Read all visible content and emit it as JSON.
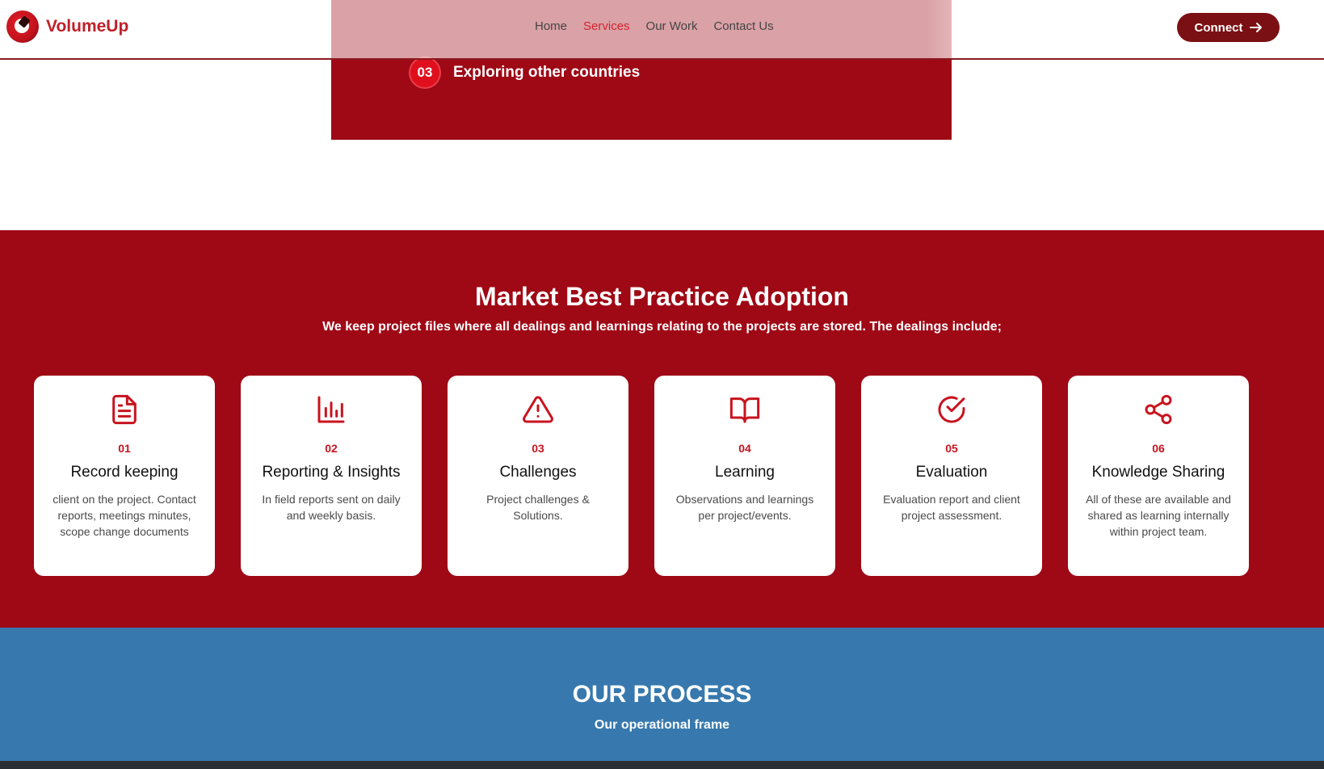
{
  "header": {
    "brand": "VolumeUp",
    "nav": [
      {
        "label": "Home",
        "active": false
      },
      {
        "label": "Services",
        "active": true
      },
      {
        "label": "Our Work",
        "active": false
      },
      {
        "label": "Contact Us",
        "active": false
      }
    ],
    "connect_label": "Connect",
    "connect_icon": "arrow-right-icon"
  },
  "top_step": {
    "number": "03",
    "label": "Exploring other countries"
  },
  "practices": {
    "title": "Market Best Practice Adoption",
    "subtitle": "We keep project files where all dealings and learnings relating to the projects are stored. The dealings include;",
    "cards": [
      {
        "icon": "document-icon",
        "number": "01",
        "title": "Record keeping",
        "description": "client on the project. Contact reports, meetings minutes, scope change documents"
      },
      {
        "icon": "bar-chart-icon",
        "number": "02",
        "title": "Reporting & Insights",
        "description": "In field reports sent on daily and weekly basis."
      },
      {
        "icon": "warning-icon",
        "number": "03",
        "title": "Challenges",
        "description": "Project challenges & Solutions."
      },
      {
        "icon": "book-icon",
        "number": "04",
        "title": "Learning",
        "description": "Observations and learnings per project/events."
      },
      {
        "icon": "check-circle-icon",
        "number": "05",
        "title": "Evaluation",
        "description": "Evaluation report and client project assessment."
      },
      {
        "icon": "share-icon",
        "number": "06",
        "title": "Knowledge Sharing",
        "description": "All of these are available and shared as learning internally within project team."
      }
    ]
  },
  "process": {
    "title": "OUR PROCESS",
    "subtitle": "Our operational frame"
  },
  "colors": {
    "brand_red": "#9f0815",
    "accent_red": "#c8141f",
    "process_blue": "#3779ae",
    "connect_button": "#7b1014"
  }
}
